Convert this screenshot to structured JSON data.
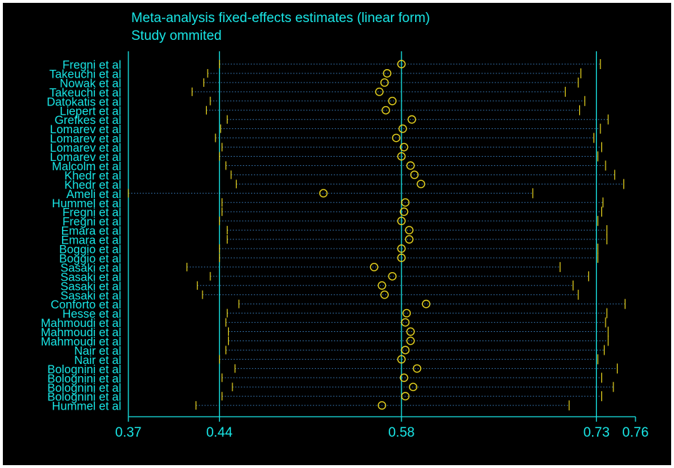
{
  "chart_data": {
    "type": "forest",
    "title": "Meta-analysis fixed-effects estimates (linear form)",
    "subtitle": "Study ommited",
    "xlim": [
      0.37,
      0.76
    ],
    "x_ticks": [
      "0.37",
      "0.44",
      "0.58",
      "0.73",
      "0.76"
    ],
    "reference_lines": {
      "lower": 0.44,
      "estimate": 0.58,
      "upper": 0.73
    },
    "colors": {
      "axis": "#19e6e6",
      "marker": "#e6d21e",
      "dotted": "#3a7fbf",
      "background": "#000000"
    },
    "studies": [
      {
        "label": "Fregni et al",
        "lower": 0.44,
        "estimate": 0.58,
        "upper": 0.733
      },
      {
        "label": "Takeuchi et al",
        "lower": 0.431,
        "estimate": 0.569,
        "upper": 0.718
      },
      {
        "label": "Nowak et al",
        "lower": 0.428,
        "estimate": 0.567,
        "upper": 0.716
      },
      {
        "label": "Takeuchi et al",
        "lower": 0.419,
        "estimate": 0.563,
        "upper": 0.706
      },
      {
        "label": "Datokatis et al",
        "lower": 0.433,
        "estimate": 0.573,
        "upper": 0.721
      },
      {
        "label": "Liepert et al",
        "lower": 0.43,
        "estimate": 0.568,
        "upper": 0.717
      },
      {
        "label": "Grefkes et al",
        "lower": 0.446,
        "estimate": 0.588,
        "upper": 0.739
      },
      {
        "label": "Lomarev et al",
        "lower": 0.441,
        "estimate": 0.581,
        "upper": 0.733
      },
      {
        "label": "Lomarev et al",
        "lower": 0.437,
        "estimate": 0.576,
        "upper": 0.728
      },
      {
        "label": "Lomarev et al",
        "lower": 0.442,
        "estimate": 0.582,
        "upper": 0.734
      },
      {
        "label": "Lomarev et al",
        "lower": 0.44,
        "estimate": 0.58,
        "upper": 0.731
      },
      {
        "label": "Malcolm et al",
        "lower": 0.445,
        "estimate": 0.587,
        "upper": 0.737
      },
      {
        "label": "Khedr et al",
        "lower": 0.449,
        "estimate": 0.59,
        "upper": 0.744
      },
      {
        "label": "Khedr et al",
        "lower": 0.453,
        "estimate": 0.595,
        "upper": 0.751
      },
      {
        "label": "Ameli et al",
        "lower": 0.37,
        "estimate": 0.52,
        "upper": 0.681
      },
      {
        "label": "Hummel et al",
        "lower": 0.442,
        "estimate": 0.583,
        "upper": 0.735
      },
      {
        "label": "Fregni et al",
        "lower": 0.442,
        "estimate": 0.582,
        "upper": 0.734
      },
      {
        "label": "Fregni et al",
        "lower": 0.44,
        "estimate": 0.58,
        "upper": 0.731
      },
      {
        "label": "Emara et al",
        "lower": 0.446,
        "estimate": 0.586,
        "upper": 0.738
      },
      {
        "label": "Emara et al",
        "lower": 0.446,
        "estimate": 0.586,
        "upper": 0.738
      },
      {
        "label": "Boggio et al",
        "lower": 0.44,
        "estimate": 0.58,
        "upper": 0.731
      },
      {
        "label": "Boggio et al",
        "lower": 0.44,
        "estimate": 0.58,
        "upper": 0.731
      },
      {
        "label": "Sasaki et al",
        "lower": 0.415,
        "estimate": 0.559,
        "upper": 0.702
      },
      {
        "label": "Sasaki et al",
        "lower": 0.433,
        "estimate": 0.573,
        "upper": 0.724
      },
      {
        "label": "Sasaki et al",
        "lower": 0.423,
        "estimate": 0.565,
        "upper": 0.712
      },
      {
        "label": "Sasaki et al",
        "lower": 0.427,
        "estimate": 0.567,
        "upper": 0.716
      },
      {
        "label": "Conforto et al",
        "lower": 0.455,
        "estimate": 0.599,
        "upper": 0.752
      },
      {
        "label": "Hesse et al",
        "lower": 0.446,
        "estimate": 0.584,
        "upper": 0.738
      },
      {
        "label": "Mahmoudi et al",
        "lower": 0.445,
        "estimate": 0.583,
        "upper": 0.737
      },
      {
        "label": "Mahmoudi et al",
        "lower": 0.447,
        "estimate": 0.587,
        "upper": 0.739
      },
      {
        "label": "Mahmoudi et al",
        "lower": 0.447,
        "estimate": 0.587,
        "upper": 0.739
      },
      {
        "label": "Nair et al",
        "lower": 0.445,
        "estimate": 0.583,
        "upper": 0.736
      },
      {
        "label": "Nair et al",
        "lower": 0.44,
        "estimate": 0.58,
        "upper": 0.731
      },
      {
        "label": "Bolognini et al",
        "lower": 0.452,
        "estimate": 0.592,
        "upper": 0.746
      },
      {
        "label": "Bolognini et al",
        "lower": 0.442,
        "estimate": 0.582,
        "upper": 0.734
      },
      {
        "label": "Bolognini et al",
        "lower": 0.45,
        "estimate": 0.589,
        "upper": 0.743
      },
      {
        "label": "Bolognini et al",
        "lower": 0.442,
        "estimate": 0.583,
        "upper": 0.734
      },
      {
        "label": "Hummel et al",
        "lower": 0.422,
        "estimate": 0.565,
        "upper": 0.709
      }
    ]
  }
}
